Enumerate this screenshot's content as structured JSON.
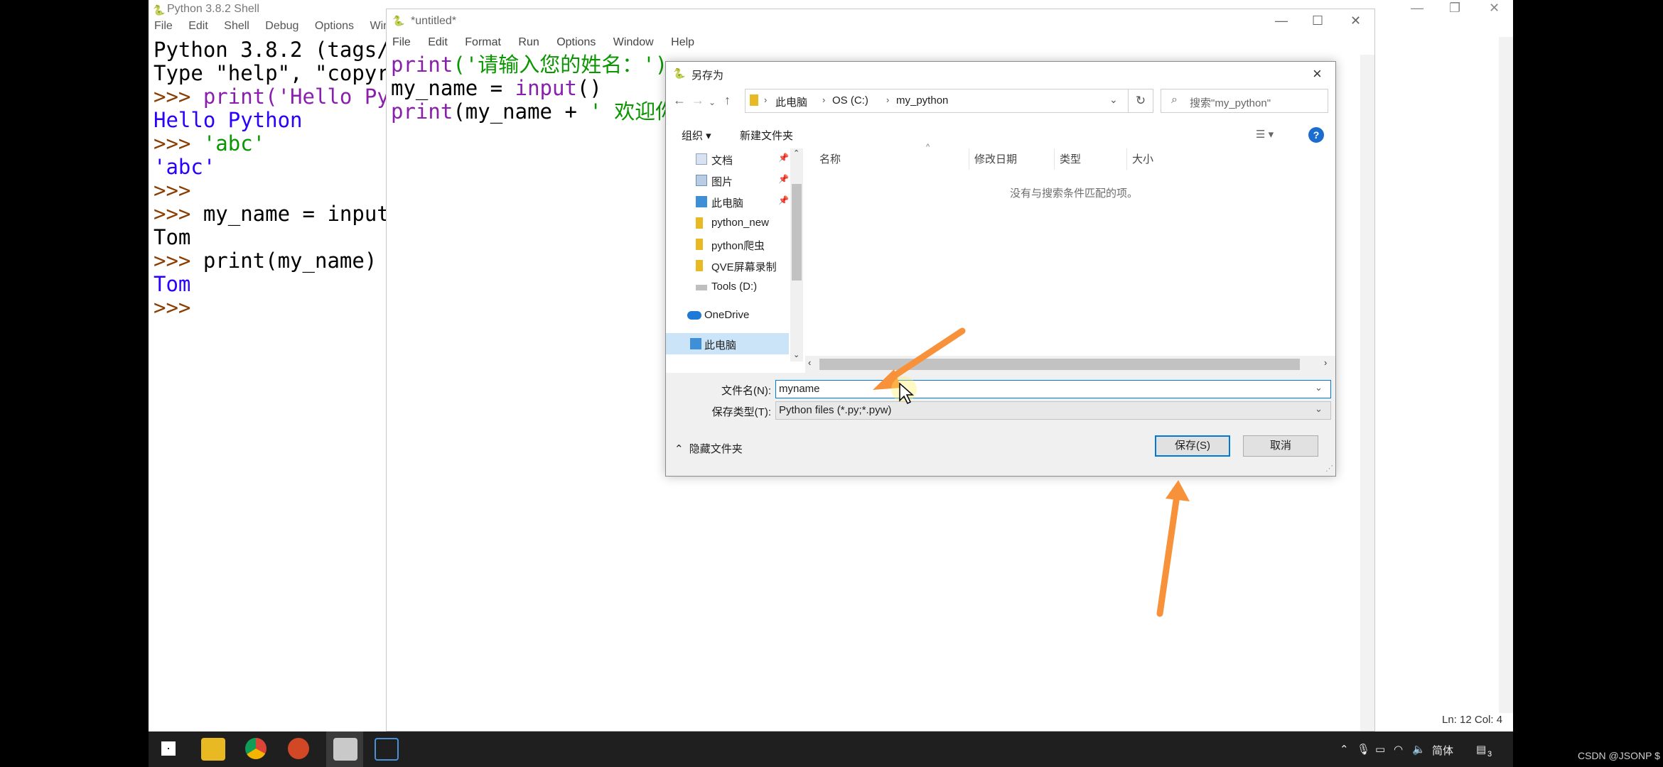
{
  "shell": {
    "title": "Python 3.8.2 Shell",
    "menu": [
      "File",
      "Edit",
      "Shell",
      "Debug",
      "Options",
      "Window"
    ],
    "lines": [
      {
        "text": "Python 3.8.2 (tags/",
        "kind": "black"
      },
      {
        "text": "Type \"help\", \"copyr",
        "kind": "black"
      },
      {
        "prompt": ">>> ",
        "text": "print('Hello Py",
        "kind": "mixed1"
      },
      {
        "text": "Hello Python",
        "kind": "blue"
      },
      {
        "prompt": ">>> ",
        "text": "'abc'",
        "kind": "green"
      },
      {
        "text": "'abc'",
        "kind": "blue"
      },
      {
        "prompt": ">>>",
        "text": "",
        "kind": "prompt"
      },
      {
        "prompt": ">>> ",
        "text": "my_name = input",
        "kind": "mixed2"
      },
      {
        "text": "Tom",
        "kind": "black"
      },
      {
        "prompt": ">>> ",
        "text": "print(my_name)",
        "kind": "mixed3"
      },
      {
        "text": "Tom",
        "kind": "blue"
      },
      {
        "prompt": ">>>",
        "text": "",
        "kind": "prompt"
      }
    ],
    "status": "Ln: 12  Col: 4"
  },
  "editor": {
    "title": "*untitled*",
    "menu": [
      "File",
      "Edit",
      "Format",
      "Run",
      "Options",
      "Window",
      "Help"
    ],
    "code": {
      "l1_fn": "print",
      "l1_str": "('请输入您的姓名：')",
      "l2_var": "my_name = ",
      "l2_fn": "input",
      "l2_rest": "()",
      "l3_fn": "print",
      "l3_rest": "(my_name + ",
      "l3_str": "' 欢迎你"
    }
  },
  "dialog": {
    "title": "另存为",
    "breadcrumb": [
      "此电脑",
      "OS (C:)",
      "my_python"
    ],
    "search_placeholder": "搜索\"my_python\"",
    "toolbar": {
      "organize": "组织 ▾",
      "new_folder": "新建文件夹"
    },
    "nav_items": [
      "文档",
      "图片",
      "此电脑",
      "python_new",
      "python爬虫",
      "QVE屏幕录制",
      "Tools (D:)",
      "OneDrive",
      "此电脑"
    ],
    "columns": [
      "名称",
      "修改日期",
      "类型",
      "大小"
    ],
    "empty_message": "没有与搜索条件匹配的项。",
    "filename_label": "文件名(N):",
    "filename_value": "myname",
    "filetype_label": "保存类型(T):",
    "filetype_value": "Python files (*.py;*.pyw)",
    "hide_folders": "隐藏文件夹",
    "save_button": "保存(S)",
    "cancel_button": "取消"
  },
  "taskbar": {
    "ime": "简体",
    "notification_count": "3"
  },
  "watermark": "CSDN @JSONP $",
  "colors": {
    "accent": "#0078d7",
    "arrow": "#f7923a",
    "string_green": "#0a9600",
    "builtin_purple": "#8a1fad",
    "output_blue": "#2b00ff"
  }
}
